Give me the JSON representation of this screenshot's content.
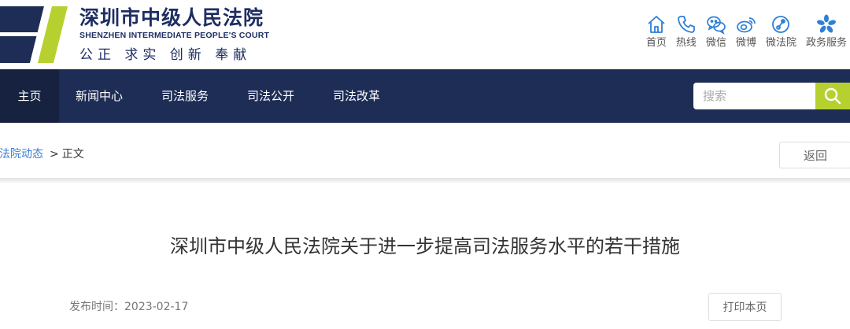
{
  "header": {
    "logo_cn": "深圳市中级人民法院",
    "logo_en": "SHENZHEN INTERMEDIATE PEOPLE'S COURT",
    "motto": "公正 求实 创新 奉献",
    "quick_links": [
      {
        "label": "首页",
        "icon": "home-icon"
      },
      {
        "label": "热线",
        "icon": "phone-icon"
      },
      {
        "label": "微信",
        "icon": "wechat-icon"
      },
      {
        "label": "微博",
        "icon": "weibo-icon"
      },
      {
        "label": "微法院",
        "icon": "micro-court-icon"
      },
      {
        "label": "政务服务",
        "icon": "gov-service-icon"
      }
    ]
  },
  "nav": {
    "items": [
      {
        "label": "主页",
        "active": true
      },
      {
        "label": "新闻中心"
      },
      {
        "label": "司法服务"
      },
      {
        "label": "司法公开"
      },
      {
        "label": "司法改革"
      }
    ],
    "search_placeholder": "搜索"
  },
  "breadcrumb": {
    "parent": "法院动态",
    "separator": ">",
    "current": "正文"
  },
  "back_label": "返回",
  "article": {
    "title": "深圳市中级人民法院关于进一步提高司法服务水平的若干措施",
    "publish_label": "发布时间：",
    "publish_date": "2023-02-17",
    "print_label": "打印本页"
  },
  "colors": {
    "brand_navy": "#1e2d55",
    "accent_green": "#b6d12f",
    "icon_blue": "#2f7fd6",
    "link_blue": "#3b7dd8"
  }
}
